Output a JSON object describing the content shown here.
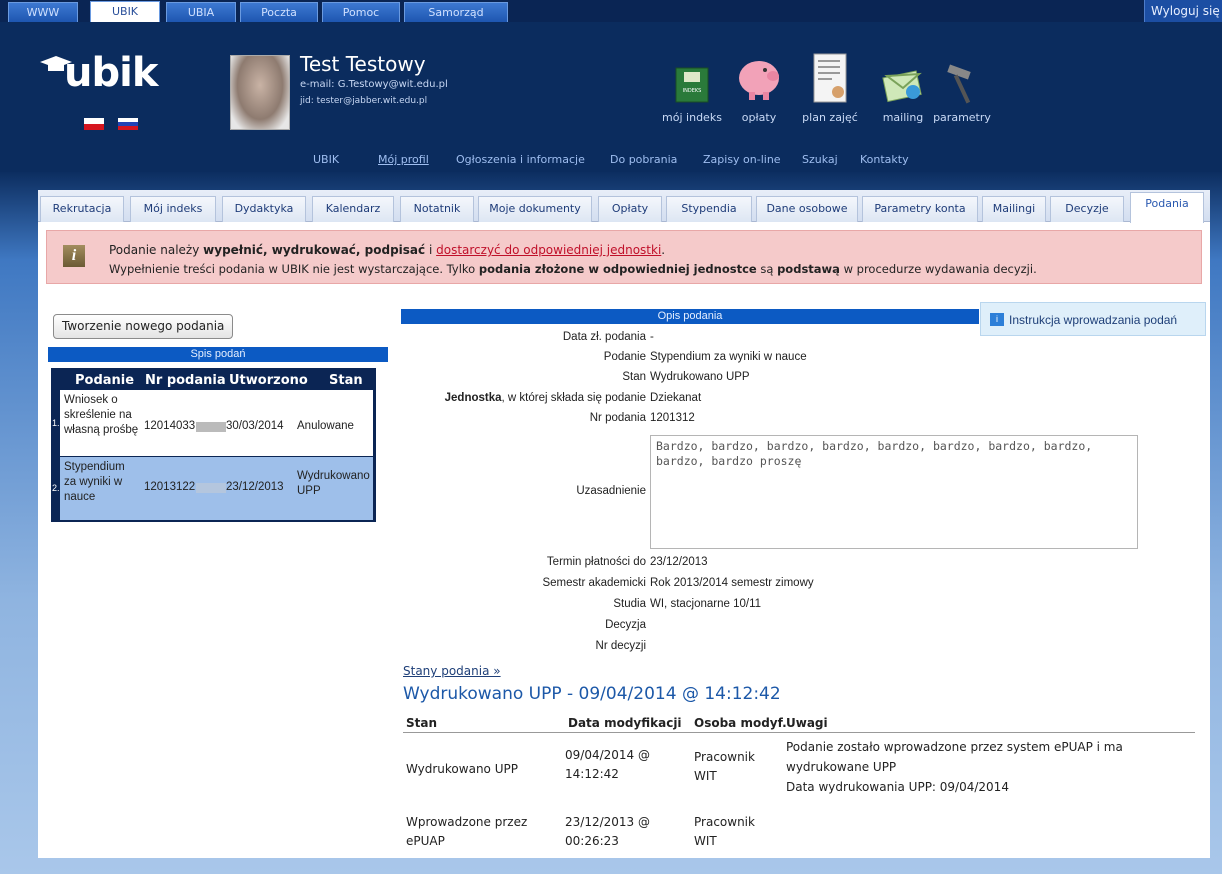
{
  "top_tabs": [
    "WWW",
    "UBIK",
    "UBIA",
    "Poczta",
    "Pomoc",
    "Samorząd"
  ],
  "logout_label": "Wyloguj się",
  "logo_text": "ubik",
  "user": {
    "name": "Test Testowy",
    "email": "e-mail: G.Testowy@wit.edu.pl",
    "jid": "jid: tester@jabber.wit.edu.pl"
  },
  "header_icons": [
    "mój indeks",
    "opłaty",
    "plan zajęć",
    "mailing",
    "parametry"
  ],
  "sub_nav": [
    "UBIK",
    "Mój profil",
    "Ogłoszenia i informacje",
    "Do pobrania",
    "Zapisy on-line",
    "Szukaj",
    "Kontakty"
  ],
  "panel_tabs": [
    "Rekrutacja",
    "Mój indeks",
    "Dydaktyka",
    "Kalendarz",
    "Notatnik",
    "Moje dokumenty",
    "Opłaty",
    "Stypendia",
    "Dane osobowe",
    "Parametry konta",
    "Mailingi",
    "Decyzje",
    "Podania"
  ],
  "alert": {
    "line1_a": "Podanie należy ",
    "line1_b": "wypełnić, wydrukować, podpisać",
    "line1_c": " i ",
    "line1_link": "dostarczyć do odpowiedniej jednostki",
    "line1_d": ".",
    "line2_a": "Wypełnienie treści podania w UBIK nie jest wystarczające. Tylko ",
    "line2_b": "podania złożone w odpowiedniej jednostce",
    "line2_c": " są ",
    "line2_d": "podstawą",
    "line2_e": " w procedurze wydawania decyzji."
  },
  "new_button": "Tworzenie nowego podania",
  "list_title": "Spis podań",
  "list_headers": [
    "Podanie",
    "Nr podania",
    "Utworzono",
    "Stan"
  ],
  "list_rows": [
    {
      "num": "1.",
      "title": "Wniosek o skreślenie na własną prośbę",
      "nr": "12014033",
      "date": "30/03/2014",
      "state": "Anulowane"
    },
    {
      "num": "2.",
      "title": "Stypendium za wyniki w nauce",
      "nr": "12013122",
      "date": "23/12/2013",
      "state": "Wydrukowano UPP"
    }
  ],
  "details_title": "Opis podania",
  "instr_label": "Instrukcja wprowadzania podań",
  "details": [
    {
      "label": "Data zł. podania",
      "value": "-"
    },
    {
      "label": "Podanie",
      "value": "Stypendium za wyniki w nauce"
    },
    {
      "label": "Stan",
      "value": "Wydrukowano UPP"
    },
    {
      "label_bold": "Jednostka",
      "label": ", w której składa się podanie",
      "value": "Dziekanat"
    },
    {
      "label": "Nr podania",
      "value": "1201312"
    },
    {
      "label": "Uzasadnienie",
      "value": "Bardzo, bardzo, bardzo, bardzo, bardzo, bardzo, bardzo, bardzo, bardzo, bardzo  proszę"
    },
    {
      "label": "Termin płatności do",
      "value": "23/12/2013"
    },
    {
      "label": "Semestr akademicki",
      "value": "Rok 2013/2014 semestr zimowy"
    },
    {
      "label": "Studia",
      "value": "WI, stacjonarne 10/11"
    },
    {
      "label": "Decyzja",
      "value": ""
    },
    {
      "label": "Nr decyzji",
      "value": ""
    }
  ],
  "states_link": "Stany podania »",
  "states_title": "Wydrukowano UPP - 09/04/2014 @ 14:12:42",
  "states_headers": [
    "Stan",
    "Data modyfikacji",
    "Osoba modyf.",
    "Uwagi"
  ],
  "states_rows": [
    {
      "state": "Wydrukowano UPP",
      "date_a": "09/04/2014 @",
      "date_b": "14:12:42",
      "person_a": "Pracownik",
      "person_b": "WIT",
      "note_a": "Podanie zostało wprowadzone przez system ePUAP i ma",
      "note_b": "wydrukowane UPP",
      "note_c": "Data wydrukowania UPP: 09/04/2014"
    },
    {
      "state_a": "Wprowadzone przez",
      "state_b": "ePUAP",
      "date_a": "23/12/2013 @",
      "date_b": "00:26:23",
      "person_a": "Pracownik",
      "person_b": "WIT"
    }
  ]
}
